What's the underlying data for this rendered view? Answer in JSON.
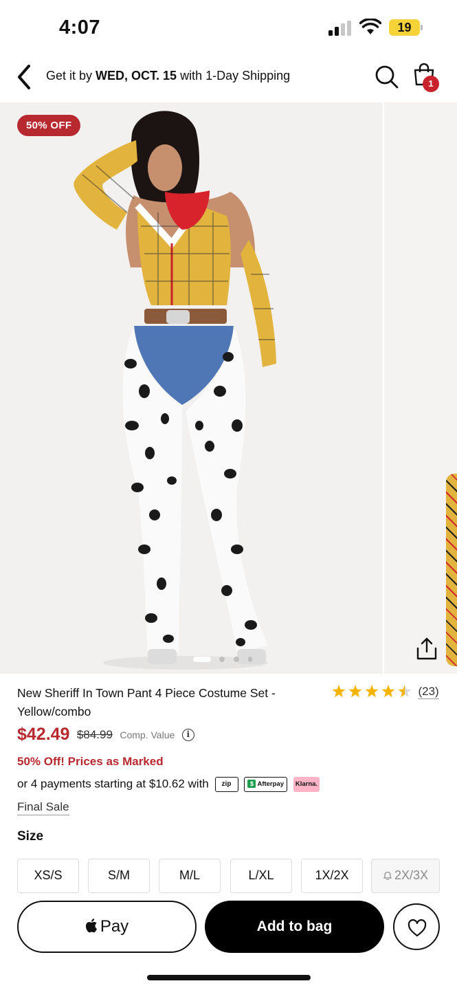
{
  "status_bar": {
    "time": "4:07",
    "battery": "19"
  },
  "header": {
    "shipping_prefix": "Get it by ",
    "shipping_date": "WED, OCT. 15",
    "shipping_suffix": " with 1-Day Shipping",
    "cart_count": "1"
  },
  "gallery": {
    "discount_badge": "50% OFF",
    "image_count": 5,
    "active_index": 0
  },
  "product": {
    "title": "New Sheriff In Town Pant 4 Piece Costume Set - Yellow/combo",
    "rating": 4.5,
    "review_count": "(23)",
    "sale_price": "$42.49",
    "original_price": "$84.99",
    "comp_label": "Comp. Value",
    "promo": "50% Off! Prices as Marked",
    "installments": "or 4 payments starting at $10.62 with",
    "payment_logos": {
      "zip": "zip",
      "afterpay": "Afterpay",
      "klarna": "Klarna."
    },
    "final_sale": "Final Sale"
  },
  "sizes": {
    "label": "Size",
    "options": [
      "XS/S",
      "S/M",
      "M/L",
      "L/XL",
      "1X/2X",
      "2X/3X"
    ]
  },
  "actions": {
    "apple_pay": "Pay",
    "add_to_bag": "Add to bag"
  },
  "colors": {
    "accent_red": "#b8282f",
    "badge_red": "#c8232c",
    "star": "#f5b400"
  }
}
